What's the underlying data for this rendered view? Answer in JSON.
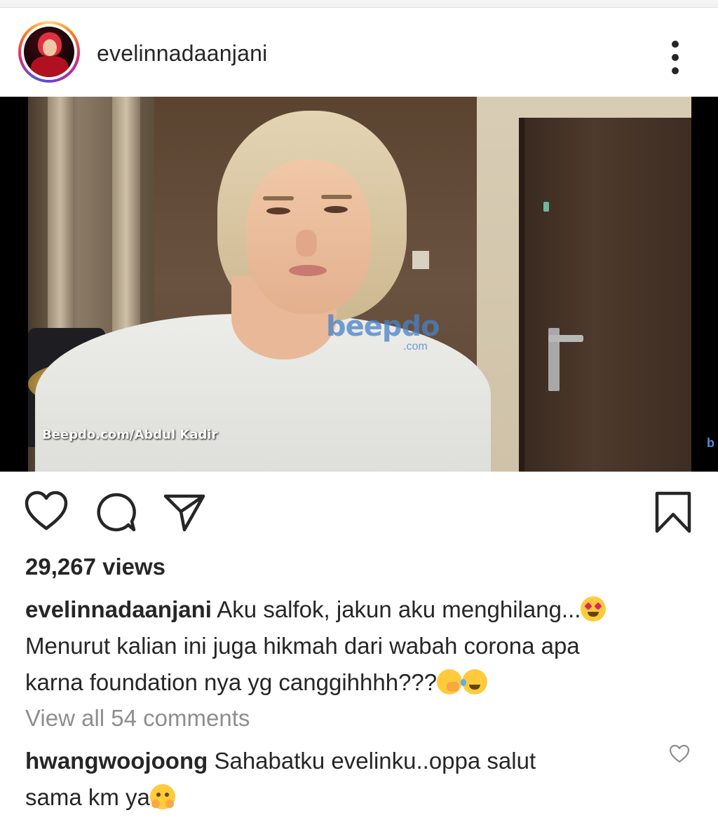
{
  "post": {
    "username": "evelinnadaanjani",
    "views": "29,267 views",
    "caption_user": "evelinnadaanjani",
    "caption_line1": "Aku salfok, jakun aku menghilang...",
    "caption_line2": "Menurut kalian ini juga hikmah dari wabah corona apa",
    "caption_line3": "karna foundation nya yg canggihhhh???",
    "view_all_comments": "View all 54 comments"
  },
  "media": {
    "watermark_logo": "beepdo",
    "watermark_com": ".com",
    "watermark_credit": "Beepdo.com/Abdul Kadir",
    "watermark_edge": "b"
  },
  "comment": {
    "username": "hwangwoojoong",
    "text_line1": "Sahabatku evelinku..oppa salut",
    "text_line2": "sama km ya"
  },
  "icons": {
    "more": "more-vertical-icon",
    "like": "heart-icon",
    "comment": "comment-icon",
    "share": "send-icon",
    "save": "bookmark-icon",
    "comment_like": "heart-small-icon"
  },
  "colors": {
    "text": "#262626",
    "muted": "#8e8e8e",
    "story_ring": "#d62976"
  }
}
